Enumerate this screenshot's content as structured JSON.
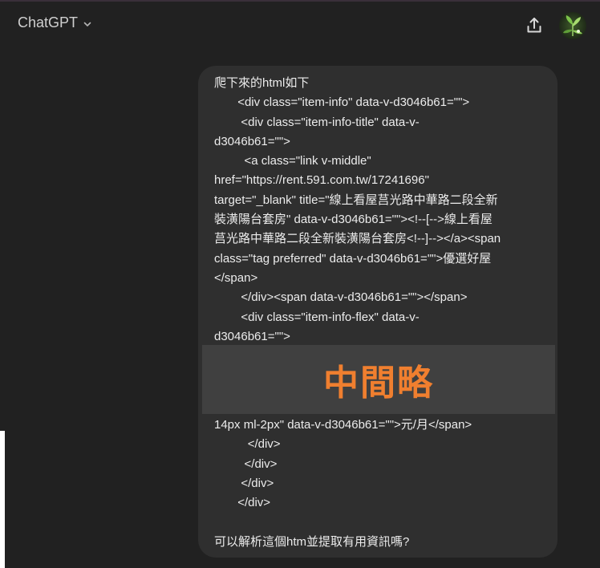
{
  "header": {
    "model_name": "ChatGPT",
    "icons": [
      "chevron-down-icon",
      "share-icon",
      "avatar"
    ]
  },
  "message": {
    "lines_before": "爬下來的html如下\n       <div class=\"item-info\" data-v-d3046b61=\"\">\n        <div class=\"item-info-title\" data-v-\nd3046b61=\"\">\n         <a class=\"link v-middle\"\nhref=\"https://rent.591.com.tw/17241696\"\ntarget=\"_blank\" title=\"線上看屋莒光路中華路二段全新\n裝潢陽台套房\" data-v-d3046b61=\"\"><!--[-->線上看屋\n莒光路中華路二段全新裝潢陽台套房<!--]--></a><span\nclass=\"tag preferred\" data-v-d3046b61=\"\">優選好屋\n</span>\n        </div><span data-v-d3046b61=\"\"></span>\n        <div class=\"item-info-flex\" data-v-\nd3046b61=\"\">",
    "omitted_label": "中間略",
    "lines_after": "14px ml-2px\" data-v-d3046b61=\"\">元/月</span>\n          </div>\n         </div>\n        </div>\n       </div>\n\n可以解析這個htm並提取有用資訊嗎?"
  },
  "colors": {
    "background": "#212121",
    "bubble": "#2f2f2f",
    "omitted_band": "#404040",
    "omitted_label": "#f07f2f",
    "text": "#ececec"
  }
}
